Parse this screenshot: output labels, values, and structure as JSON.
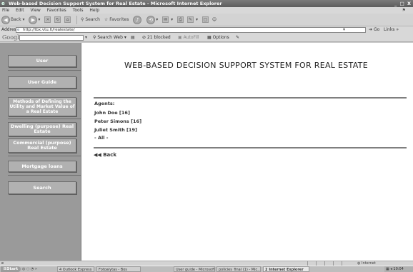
{
  "window": {
    "title": "Web-based Decision Support System for Real Estate - Microsoft Internet Explorer",
    "controls": "_ □ X"
  },
  "menubar": [
    "File",
    "Edit",
    "View",
    "Favorites",
    "Tools",
    "Help"
  ],
  "toolbar": {
    "back_label": "Back",
    "search_label": "Search",
    "favorites_label": "Favorites"
  },
  "addressbar": {
    "label": "Address",
    "url": "http://lbx.vtu.lt/realestate/",
    "go_label": "Go",
    "links_label": "Links"
  },
  "googlebar": {
    "logo": "Google",
    "search_web_label": "Search Web",
    "blocked_label": "21 blocked",
    "autofill_label": "AutoFill",
    "options_label": "Options"
  },
  "sidebar": {
    "items": [
      {
        "label": "User"
      },
      {
        "label": "User Guide"
      },
      {
        "label": "Methods of Defining the Utility and Market Value of a Real Estate"
      },
      {
        "label": "Dwelling (purpose) Real Estate"
      },
      {
        "label": "Commercial (purpose) Real Estate"
      },
      {
        "label": "Mortgage loans"
      },
      {
        "label": "Search"
      }
    ]
  },
  "main": {
    "title": "WEB-BASED DECISION SUPPORT SYSTEM FOR REAL ESTATE",
    "agents_heading": "Agents:",
    "agents": [
      "John Doe [16]",
      "Peter Simons [16]",
      "Juliet Smith [19]",
      "- All -"
    ],
    "back_label": "Back"
  },
  "statusbar": {
    "zone": "Internet"
  },
  "taskbar": {
    "start_label": "Start",
    "tasks": [
      {
        "label": "4 Outlook Express"
      },
      {
        "label": "Fotoalytas - Bos"
      },
      {
        "label": "User guide - Microsoft..."
      },
      {
        "label": "policies_final (1) - Mic..."
      },
      {
        "label": "2 Internet Explorer"
      }
    ],
    "clock": "10:04"
  }
}
